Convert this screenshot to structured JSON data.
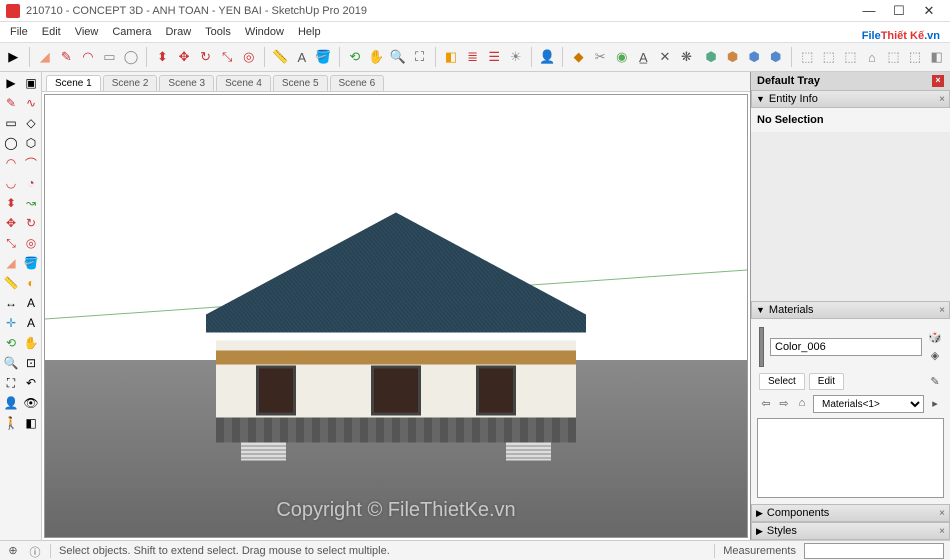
{
  "window": {
    "title": "210710 - CONCEPT 3D - ANH TOAN - YEN BAI - SketchUp Pro 2019"
  },
  "menu": [
    "File",
    "Edit",
    "View",
    "Camera",
    "Draw",
    "Tools",
    "Window",
    "Help"
  ],
  "scenes": [
    "Scene 1",
    "Scene 2",
    "Scene 3",
    "Scene 4",
    "Scene 5",
    "Scene 6"
  ],
  "active_scene": 0,
  "tray": {
    "title": "Default Tray",
    "panels": {
      "entity": {
        "title": "Entity Info",
        "content": "No Selection"
      },
      "materials": {
        "title": "Materials",
        "current": "Color_006",
        "tabs": [
          "Select",
          "Edit"
        ],
        "library": "Materials<1>"
      },
      "components": {
        "title": "Components"
      },
      "styles": {
        "title": "Styles"
      }
    }
  },
  "status": {
    "hint": "Select objects. Shift to extend select. Drag mouse to select multiple.",
    "measurements_label": "Measurements"
  },
  "watermark": {
    "text": "Copyright © FileThietKe.vn",
    "logo_a": "File",
    "logo_b": "Thiết Kế",
    "logo_c": ".vn"
  }
}
